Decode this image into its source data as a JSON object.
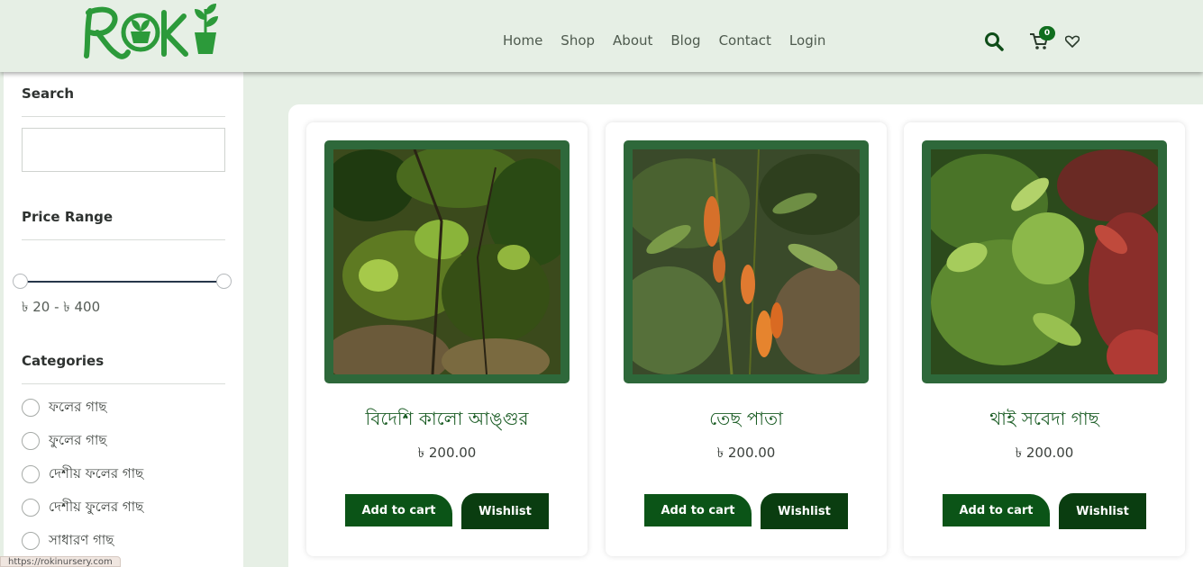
{
  "header": {
    "logo_text": "ROKI",
    "nav": [
      "Home",
      "Shop",
      "About",
      "Blog",
      "Contact",
      "Login"
    ],
    "cart_count": "0",
    "icons": [
      "search-icon",
      "cart-icon",
      "heart-icon"
    ],
    "accent_color": "#106e1e"
  },
  "sidebar": {
    "search": {
      "title": "Search",
      "value": "",
      "placeholder": ""
    },
    "price": {
      "title": "Price Range",
      "range_text": "৳ 20 - ৳ 400",
      "min": 20,
      "max": 400
    },
    "categories": {
      "title": "Categories",
      "items": [
        {
          "label": "ফলের গাছ"
        },
        {
          "label": "ফুলের গাছ"
        },
        {
          "label": "দেশীয় ফলের গাছ"
        },
        {
          "label": "দেশীয় ফুলের গাছ"
        },
        {
          "label": "সাধারণ গাছ"
        }
      ]
    }
  },
  "products": [
    {
      "title": "বিদেশি কালো আঙ্গুর",
      "price": "৳ 200.00",
      "cart_label": "Add to cart",
      "wish_label": "Wishlist"
    },
    {
      "title": "তেছ পাতা",
      "price": "৳ 200.00",
      "cart_label": "Add to cart",
      "wish_label": "Wishlist"
    },
    {
      "title": "থাই সবেদা গাছ",
      "price": "৳ 200.00",
      "cart_label": "Add to cart",
      "wish_label": "Wishlist"
    }
  ],
  "status_url": "https://rokinursery.com"
}
